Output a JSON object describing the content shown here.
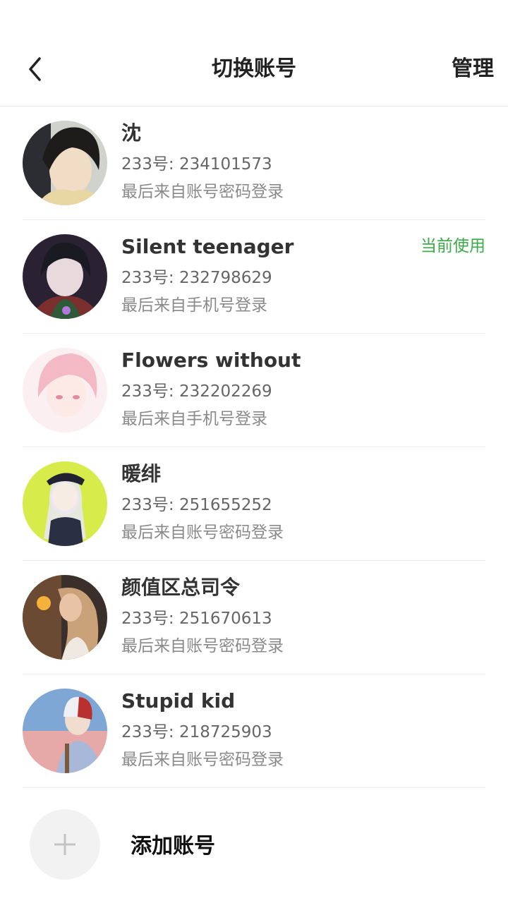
{
  "header": {
    "back_icon": "chevron-left-icon",
    "title": "切换账号",
    "manage_label": "管理"
  },
  "accounts": [
    {
      "name": "沈",
      "uid": "233号: 234101573",
      "login": "最后来自账号密码登录",
      "current": ""
    },
    {
      "name": "Silent teenager",
      "uid": "233号: 232798629",
      "login": "最后来自手机号登录",
      "current": "当前使用"
    },
    {
      "name": "Flowers without",
      "uid": "233号: 232202269",
      "login": "最后来自手机号登录",
      "current": ""
    },
    {
      "name": "暖绯",
      "uid": "233号: 251655252",
      "login": "最后来自账号密码登录",
      "current": ""
    },
    {
      "name": "颜值区总司令",
      "uid": "233号: 251670613",
      "login": "最后来自账号密码登录",
      "current": ""
    },
    {
      "name": "Stupid kid",
      "uid": "233号: 218725903",
      "login": "最后来自账号密码登录",
      "current": ""
    }
  ],
  "add_account": {
    "icon": "plus-icon",
    "label": "添加账号"
  },
  "colors": {
    "current_badge": "#3bab48",
    "divider": "#ececec"
  }
}
